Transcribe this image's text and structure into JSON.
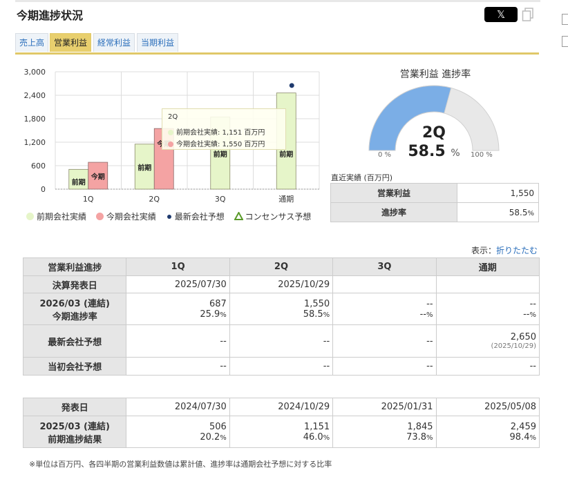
{
  "title": "今期進捗状況",
  "share": {
    "x_label": "𝕏"
  },
  "tabs": [
    "売上高",
    "営業利益",
    "経常利益",
    "当期利益"
  ],
  "active_tab": 1,
  "chart_data": {
    "type": "bar",
    "categories": [
      "1Q",
      "2Q",
      "3Q",
      "通期"
    ],
    "yticks": [
      "3,000",
      "2,400",
      "1,800",
      "1,200",
      "600",
      "0"
    ],
    "ylim": [
      0,
      3000
    ],
    "series": [
      {
        "name": "前期会社実績",
        "values": [
          506,
          1151,
          1845,
          2459
        ],
        "color": "#e6f5c9",
        "bar_label": "前期"
      },
      {
        "name": "今期会社実績",
        "values": [
          687,
          1550,
          null,
          null
        ],
        "color": "#f4a3a3",
        "bar_label": "今期"
      },
      {
        "name": "最新会社予想",
        "values": [
          null,
          null,
          null,
          2650
        ],
        "color": "#1f3a6e",
        "marker": "dot"
      },
      {
        "name": "コンセンサス予想",
        "values": [
          null,
          null,
          null,
          null
        ],
        "color": "#5a9a2a",
        "marker": "triangle"
      }
    ],
    "grid": true,
    "legend": "bottom"
  },
  "tooltip": {
    "title": "2Q",
    "rows": [
      "前期会社実績: 1,151 百万円",
      "今期会社実績: 1,550 百万円"
    ]
  },
  "gauge": {
    "title": "営業利益 進捗率",
    "quarter": "2Q",
    "value": "58.5",
    "unit": "%",
    "min_label": "0 %",
    "max_label": "100 %",
    "fraction": 0.585,
    "fill_color": "#7baee6",
    "track_color": "#e8e8e8"
  },
  "recent": {
    "label": "直近実績 (百万円)",
    "rows": [
      {
        "h": "営業利益",
        "v": "1,550",
        "u": ""
      },
      {
        "h": "進捗率",
        "v": "58.5",
        "u": "%"
      }
    ]
  },
  "display": {
    "label": "表示：",
    "link": "折りたたむ"
  },
  "progress_table": {
    "headers": [
      "営業利益進捗",
      "1Q",
      "2Q",
      "3Q",
      "通期"
    ],
    "announce": {
      "h": "決算発表日",
      "cells": [
        "2025/07/30",
        "2025/10/29",
        "",
        ""
      ]
    },
    "current": {
      "h1": "2026/03 (連結)",
      "h2": "今期進捗率",
      "vals": [
        "687",
        "1,550",
        "--",
        "--"
      ],
      "rates": [
        "25.9",
        "58.5",
        "--",
        "--"
      ]
    },
    "latest": {
      "h": "最新会社予想",
      "cells": [
        "--",
        "--",
        "--",
        "2,650"
      ],
      "note": "(2025/10/29)"
    },
    "initial": {
      "h": "当初会社予想",
      "cells": [
        "--",
        "--",
        "--",
        "--"
      ]
    }
  },
  "prev_table": {
    "date_h": "発表日",
    "dates": [
      "2024/07/30",
      "2024/10/29",
      "2025/01/31",
      "2025/05/08"
    ],
    "h1": "2025/03 (連結)",
    "h2": "前期進捗結果",
    "vals": [
      "506",
      "1,151",
      "1,845",
      "2,459"
    ],
    "rates": [
      "20.2",
      "46.0",
      "73.8",
      "98.4"
    ]
  },
  "pct": "%",
  "note": "※単位は百万円、各四半期の営業利益数値は累計値、進捗率は通期会社予想に対する比率"
}
